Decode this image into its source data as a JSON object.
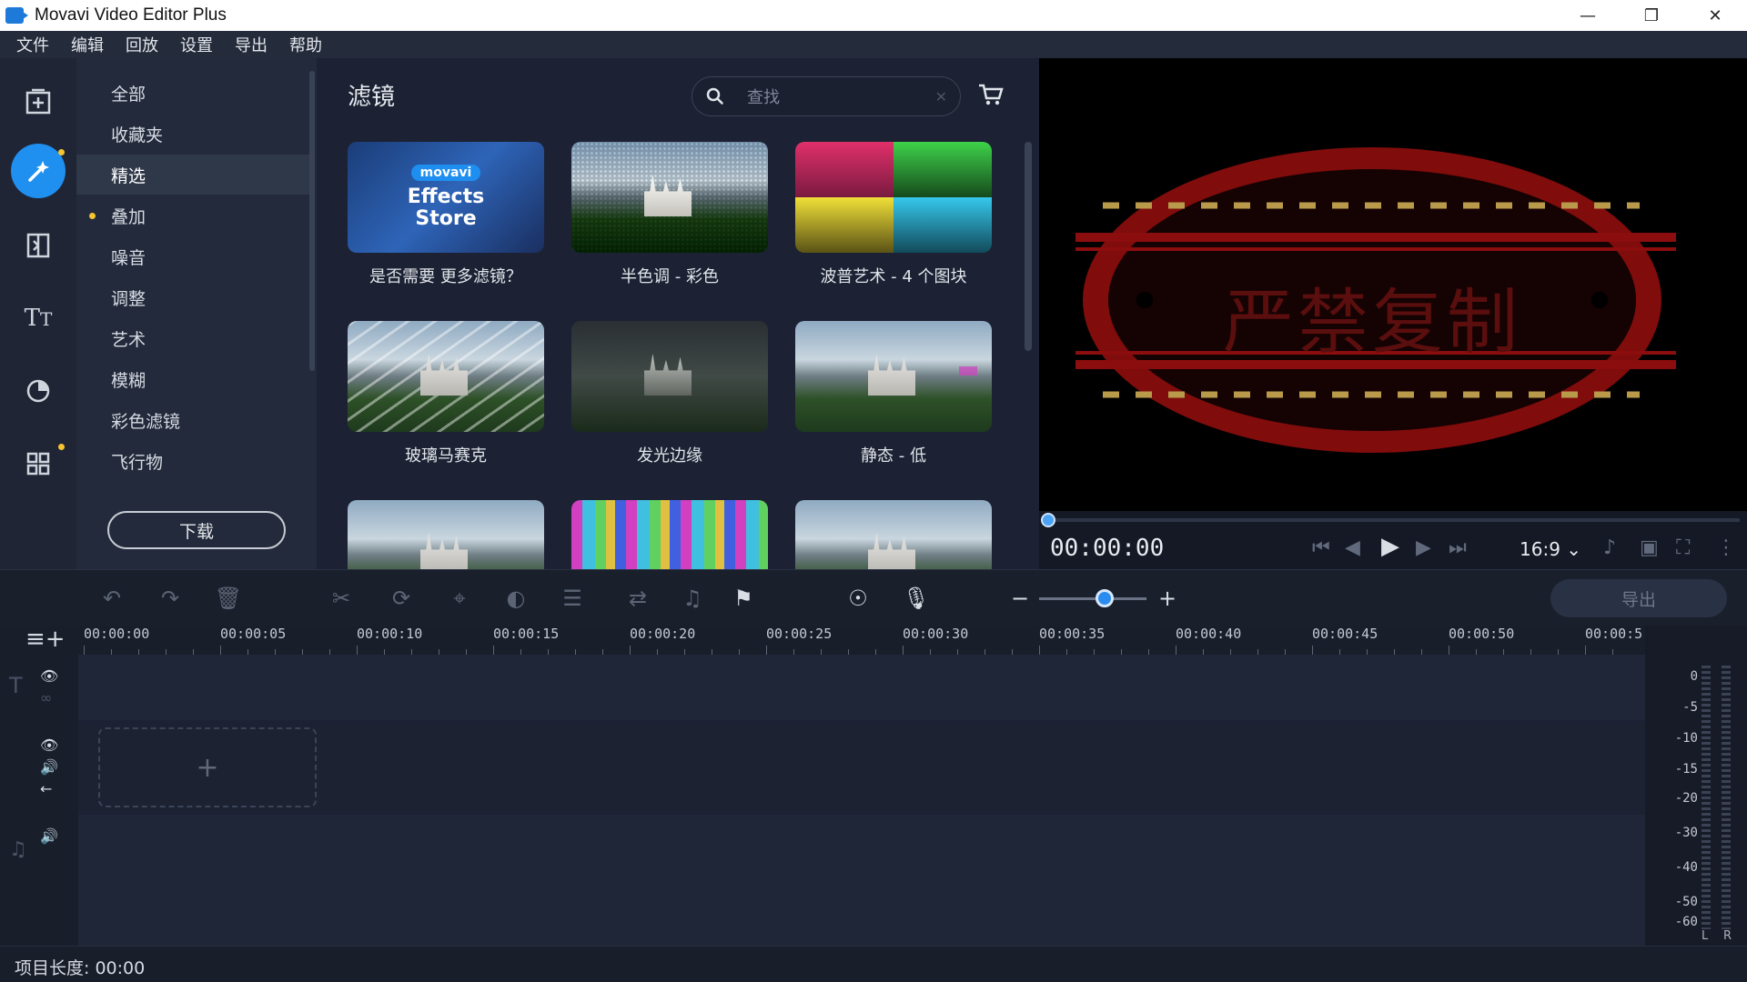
{
  "window": {
    "title": "Movavi Video Editor Plus"
  },
  "menu": [
    "文件",
    "编辑",
    "回放",
    "设置",
    "导出",
    "帮助"
  ],
  "categories": [
    {
      "label": "全部"
    },
    {
      "label": "收藏夹"
    },
    {
      "label": "精选",
      "active": true
    },
    {
      "label": "叠加",
      "dot": true
    },
    {
      "label": "噪音"
    },
    {
      "label": "调整"
    },
    {
      "label": "艺术"
    },
    {
      "label": "模糊"
    },
    {
      "label": "彩色滤镜"
    },
    {
      "label": "飞行物"
    }
  ],
  "download_label": "下载",
  "filters": {
    "title": "滤镜",
    "search_placeholder": "查找",
    "store_badge": "movavi",
    "store_line1": "Effects",
    "store_line2": "Store",
    "tiles": [
      {
        "label": "是否需要 更多滤镜？",
        "kind": "store"
      },
      {
        "label": "半色调 - 彩色",
        "kind": "halftone"
      },
      {
        "label": "波普艺术 - 4 个图块",
        "kind": "pop4"
      },
      {
        "label": "玻璃马赛克",
        "kind": "glass"
      },
      {
        "label": "发光边缘",
        "kind": "glow"
      },
      {
        "label": "静态 - 低",
        "kind": "static"
      },
      {
        "label": "",
        "kind": "plain"
      },
      {
        "label": "",
        "kind": "glitch"
      },
      {
        "label": "",
        "kind": "plain"
      }
    ]
  },
  "preview": {
    "timecode": "00:00:00",
    "ratio": "16:9",
    "watermark": "严禁复制"
  },
  "toolbar": {
    "export_label": "导出"
  },
  "timeline": {
    "ticks": [
      "00:00:00",
      "00:00:05",
      "00:00:10",
      "00:00:15",
      "00:00:20",
      "00:00:25",
      "00:00:30",
      "00:00:35",
      "00:00:40",
      "00:00:45",
      "00:00:50",
      "00:00:5"
    ]
  },
  "meter": {
    "db_labels": [
      "0",
      "-5",
      "-10",
      "-15",
      "-20",
      "-30",
      "-40",
      "-50",
      "-60"
    ],
    "left": "L",
    "right": "R"
  },
  "status": {
    "project_length": "项目长度: 00:00"
  },
  "colors": {
    "accent": "#1f8ff0",
    "dot": "#f5c531",
    "watermark_red": "#8b0d0d"
  }
}
